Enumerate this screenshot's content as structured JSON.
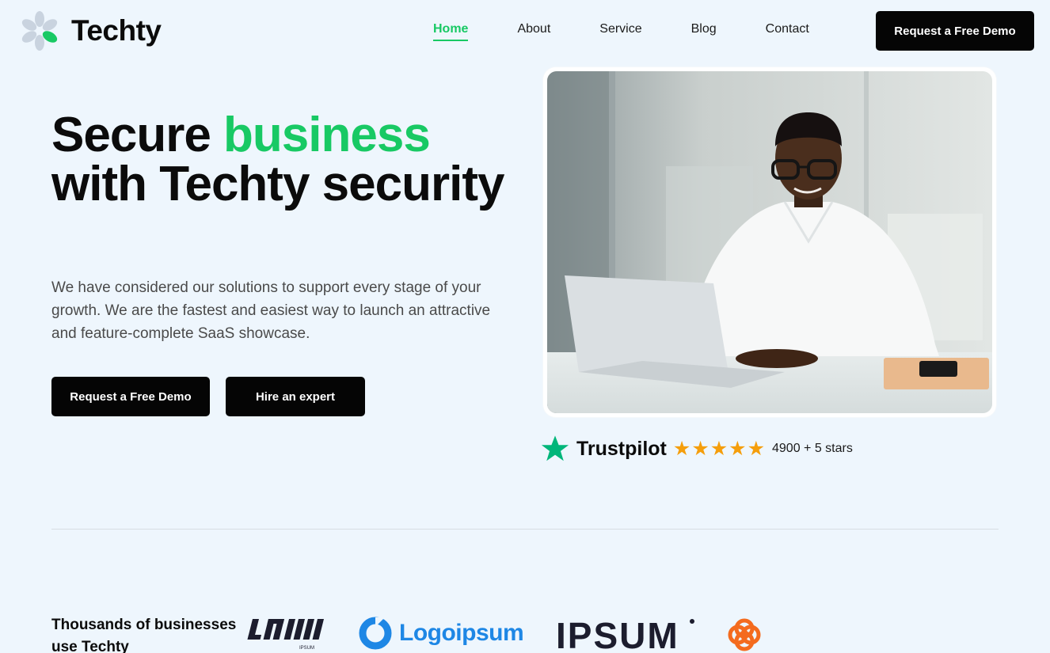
{
  "brand": {
    "name": "Techty",
    "accent_color": "#18c964",
    "icon": "flower-logo-icon"
  },
  "nav": {
    "items": [
      {
        "label": "Home",
        "active": true
      },
      {
        "label": "About",
        "active": false
      },
      {
        "label": "Service",
        "active": false
      },
      {
        "label": "Blog",
        "active": false
      },
      {
        "label": "Contact",
        "active": false
      }
    ],
    "cta_label": "Request a Free Demo"
  },
  "hero": {
    "title_part1": "Secure ",
    "title_accent": "business",
    "title_part2": "with Techty security",
    "description": "We have considered our solutions to support every stage of your growth. We are the fastest and easiest way to launch an attractive and feature-complete SaaS showcase.",
    "primary_button": "Request a Free Demo",
    "secondary_button": "Hire an expert"
  },
  "trustpilot": {
    "name": "Trustpilot",
    "rating_stars": 5,
    "rating_text": "4900 + 5 stars",
    "star_color": "#f59e0b",
    "icon_color": "#00b67a"
  },
  "clients": {
    "label": "Thousands of businesses use Techty",
    "logos": [
      {
        "text": "LOGO",
        "caption": "IPSUM",
        "icon": "logo-ipsum-stripes-icon"
      },
      {
        "text": "Logoipsum",
        "icon": "ring-logo-icon",
        "color": "#1e87e5"
      },
      {
        "text": "IPSUM",
        "icon": "ipsum-wordmark-icon"
      },
      {
        "text": "",
        "icon": "orange-knot-logo-icon",
        "color": "#f46b1e"
      }
    ]
  }
}
